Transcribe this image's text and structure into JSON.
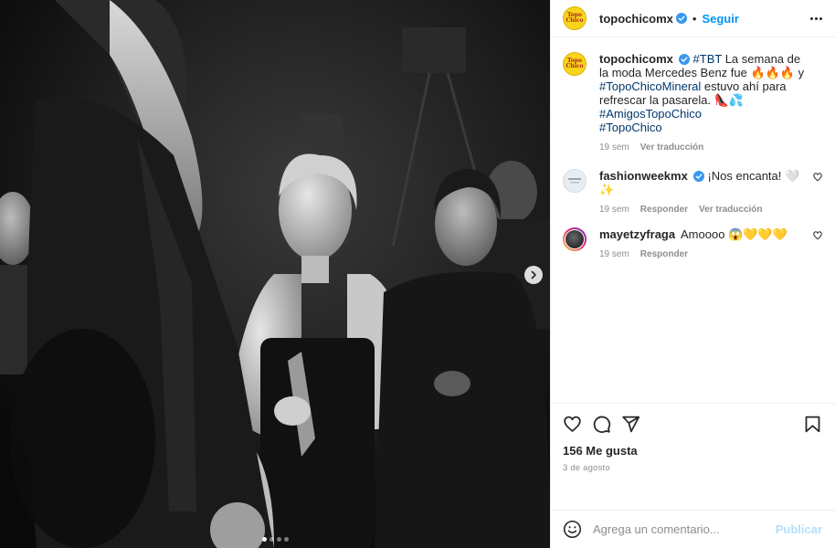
{
  "header": {
    "username": "topochicomx",
    "separator": "•",
    "follow_label": "Seguir",
    "logo_text": "Topo Chico"
  },
  "caption": {
    "username": "topochicomx",
    "text_1": "#TBT",
    "text_2": " La semana de la moda Mercedes Benz fue 🔥🔥🔥 y ",
    "hashtag_1": "#TopoChicoMineral",
    "text_3": " estuvo ahí para refrescar la pasarela. 👠💦",
    "hashtag_2": "#AmigosTopoChico",
    "hashtag_3": "#TopoChico",
    "time": "19 sem",
    "translate": "Ver traducción"
  },
  "comments": [
    {
      "username": "fashionweekmx",
      "text": "¡Nos encanta! 🤍✨",
      "time": "19 sem",
      "reply": "Responder",
      "translate": "Ver traducción"
    },
    {
      "username": "mayetzyfraga",
      "text": "Amoooo 😱💛💛💛",
      "time": "19 sem",
      "reply": "Responder"
    }
  ],
  "stats": {
    "likes": "156 Me gusta",
    "date": "3 de agosto"
  },
  "add_comment": {
    "placeholder": "Agrega un comentario...",
    "publish": "Publicar"
  },
  "icons": {
    "more": "more-options-icon",
    "like": "heart-icon",
    "comment": "comment-icon",
    "share": "share-icon",
    "save": "bookmark-icon",
    "emoji": "emoji-icon",
    "next": "chevron-right-icon"
  },
  "carousel": {
    "slides": 4,
    "active": 0
  },
  "colors": {
    "link": "#00376b",
    "follow": "#0095f6",
    "muted": "#8e8e8e",
    "publish_disabled": "#b2dffc"
  }
}
